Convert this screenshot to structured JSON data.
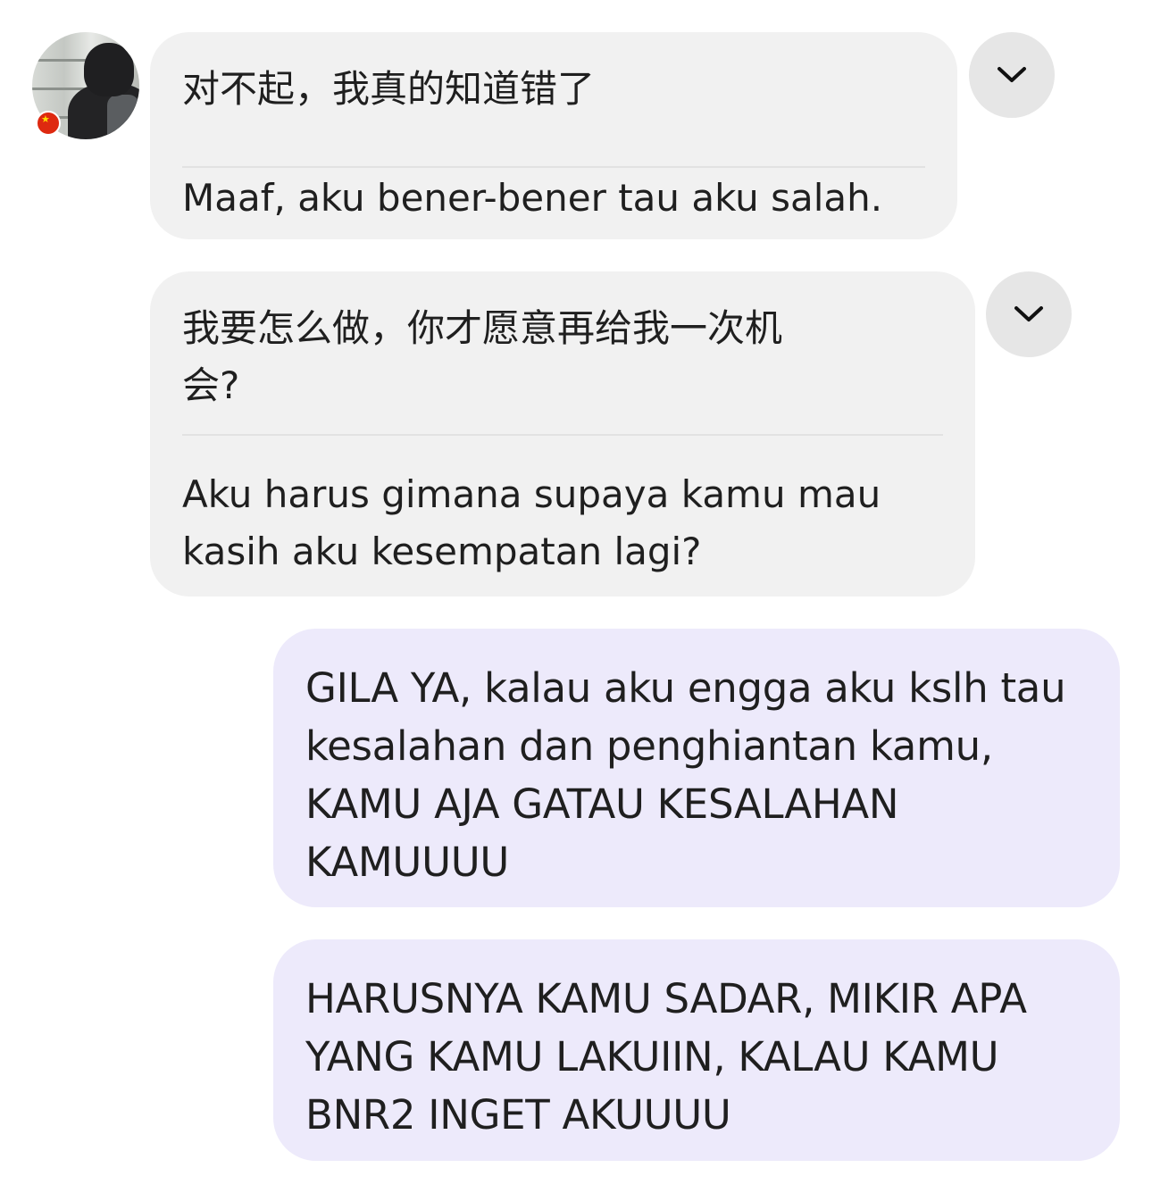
{
  "contact": {
    "avatar_icon": "profile-photo",
    "flag_icon": "china-flag-icon",
    "flag_colors": {
      "field": "#de2910",
      "star": "#ffde00"
    }
  },
  "messages": [
    {
      "direction": "incoming",
      "original": "对不起，我真的知道错了",
      "translation": "Maaf, aku bener-bener tau aku salah.",
      "expand_icon": "chevron-down-icon"
    },
    {
      "direction": "incoming",
      "original": "我要怎么做，你才愿意再给我一次机\n会?",
      "translation": "Aku harus gimana supaya kamu mau\nkasih aku kesempatan lagi?",
      "expand_icon": "chevron-down-icon"
    },
    {
      "direction": "outgoing",
      "text": "GILA YA, kalau aku engga aku kslh tau\nkesalahan dan penghiantan kamu,\nKAMU AJA GATAU KESALAHAN\nKAMUUUU"
    },
    {
      "direction": "outgoing",
      "text": "HARUSNYA KAMU SADAR, MIKIR APA\nYANG KAMU LAKUIIN, KALAU KAMU\nBNR2 INGET AKUUUU"
    }
  ],
  "colors": {
    "incoming_bubble": "#f1f1f1",
    "outgoing_bubble": "#edeafb",
    "chevron_button": "#e6e6e6",
    "text": "#1f1f1f"
  }
}
